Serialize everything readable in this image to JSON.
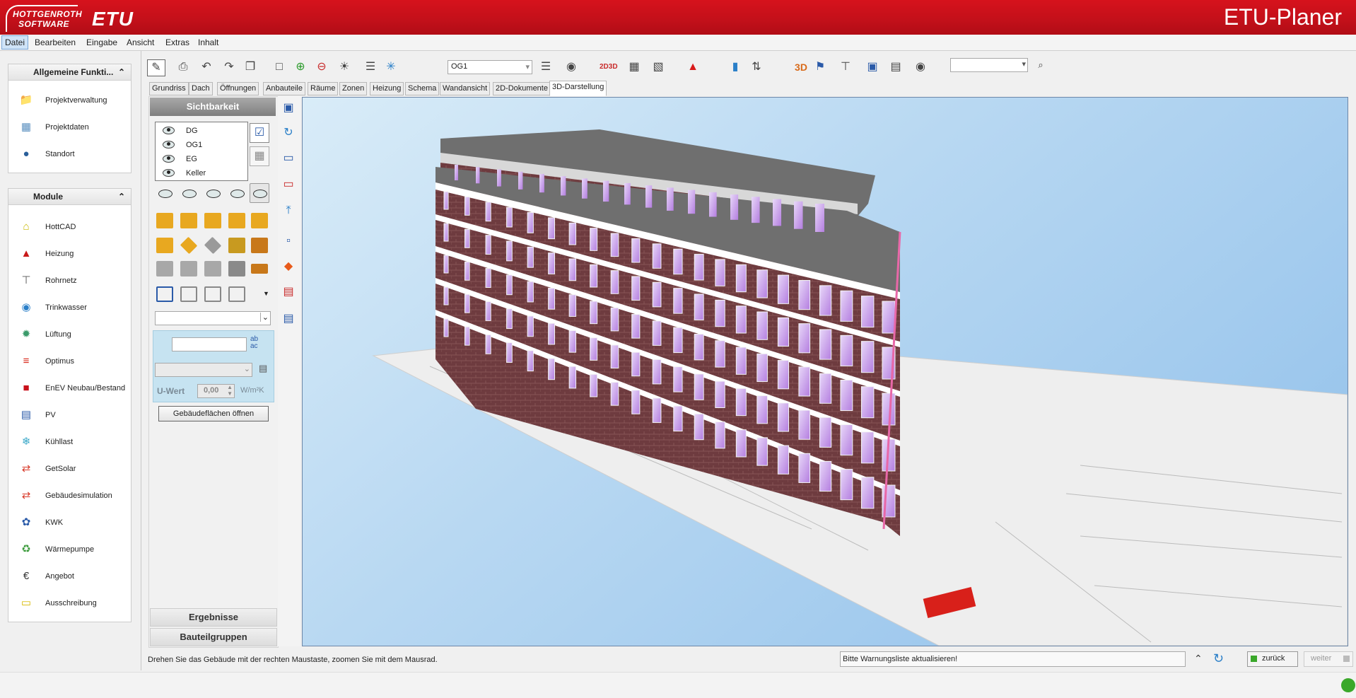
{
  "app": {
    "title": "ETU-Planer",
    "logo_line1": "HOTTGENROTH",
    "logo_line2": "SOFTWARE",
    "logo_brand": "ETU"
  },
  "menu": [
    "Datei",
    "Bearbeiten",
    "Eingabe",
    "Ansicht",
    "Extras",
    "Inhalt"
  ],
  "sidebar": {
    "general_title": "Allgemeine Funkti...",
    "general_items": [
      {
        "label": "Projektverwaltung",
        "icon": "folder-icon"
      },
      {
        "label": "Projektdaten",
        "icon": "data-sheet-icon"
      },
      {
        "label": "Standort",
        "icon": "globe-icon"
      }
    ],
    "modules_title": "Module",
    "modules": [
      {
        "label": "HottCAD",
        "icon": "house-icon"
      },
      {
        "label": "Heizung",
        "icon": "heating-icon"
      },
      {
        "label": "Rohrnetz",
        "icon": "pipe-icon"
      },
      {
        "label": "Trinkwasser",
        "icon": "water-drop-icon"
      },
      {
        "label": "Lüftung",
        "icon": "ventilation-icon"
      },
      {
        "label": "Optimus",
        "icon": "optimus-icon"
      },
      {
        "label": "EnEV Neubau/Bestand",
        "icon": "enev-icon"
      },
      {
        "label": "PV",
        "icon": "solar-panel-icon"
      },
      {
        "label": "Kühllast",
        "icon": "snowflake-icon"
      },
      {
        "label": "GetSolar",
        "icon": "getsolar-icon"
      },
      {
        "label": "Gebäudesimulation",
        "icon": "simulation-icon"
      },
      {
        "label": "KWK",
        "icon": "kwk-icon"
      },
      {
        "label": "Wärmepumpe",
        "icon": "heat-pump-icon"
      },
      {
        "label": "Angebot",
        "icon": "euro-icon"
      },
      {
        "label": "Ausschreibung",
        "icon": "document-icon"
      }
    ]
  },
  "toolbar": {
    "floor_select": "OG1",
    "search_value": ""
  },
  "tabs": [
    "Grundriss",
    "Dach",
    "Öffnungen",
    "Anbauteile",
    "Räume",
    "Zonen",
    "Heizung",
    "Schema",
    "Wandansicht",
    "2D-Dokumente",
    "3D-Darstellung"
  ],
  "active_tab": "3D-Darstellung",
  "visibility": {
    "title": "Sichtbarkeit",
    "layers": [
      "DG",
      "OG1",
      "EG",
      "Keller"
    ],
    "uwert_label": "U-Wert",
    "uwert_value": "0,00",
    "uwert_unit": "W/m²K",
    "open_button": "Gebäudeflächen öffnen",
    "results_label": "Ergebnisse",
    "component_groups_label": "Bauteilgruppen"
  },
  "status": {
    "hint": "Drehen Sie das Gebäude mit der rechten Maustaste, zoomen Sie mit dem Mausrad.",
    "warning": "Bitte Warnungsliste aktualisieren!",
    "back": "zurück",
    "next": "weiter"
  },
  "colors": {
    "brand_red": "#c8101a",
    "brick": "#6b3a3c",
    "sky": "#a9cdee",
    "window": "#c8a8e8"
  }
}
